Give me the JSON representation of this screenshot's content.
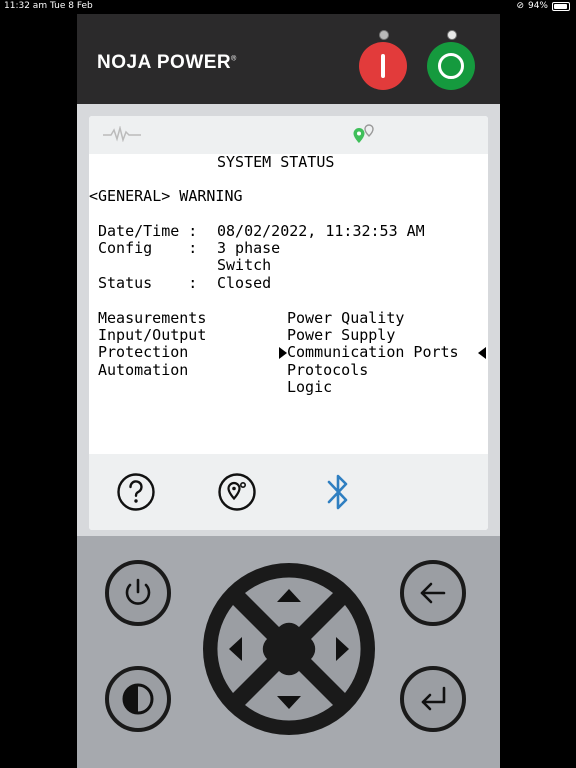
{
  "status_bar": {
    "time": "11:32 am",
    "date": "Tue 8 Feb",
    "battery": "94%",
    "battery_level": 0.94
  },
  "device": {
    "brand": "NOJA POWER",
    "brand_mark": "®",
    "colors": {
      "trip": "#e23b3b",
      "close": "#159a3e",
      "bluetooth": "#2f7fc1",
      "location_active": "#3fbf5a"
    }
  },
  "screen": {
    "title": "SYSTEM STATUS",
    "warning": "<GENERAL> WARNING",
    "fields": {
      "datetime_label": "Date/Time :",
      "datetime_value": "08/02/2022, 11:32:53 AM",
      "config_label": "Config    :",
      "config_value": "3 phase",
      "config_value2": "Switch",
      "status_label": "Status    :",
      "status_value": "Closed"
    },
    "menu_left": [
      "Measurements",
      "Input/Output",
      "Protection",
      "Automation"
    ],
    "menu_right": [
      "Power Quality",
      "Power Supply",
      "Communication Ports",
      "Protocols",
      "Logic"
    ],
    "selected_index": 2,
    "toolbar_icons": [
      "help-icon",
      "location-icon",
      "bluetooth-icon"
    ],
    "topbar_icons": [
      "waveform-icon",
      "location-pin-icon"
    ]
  },
  "keypad": {
    "buttons": [
      "power-icon",
      "contrast-icon",
      "back-arrow-icon",
      "enter-icon"
    ],
    "dpad": [
      "up-icon",
      "down-icon",
      "left-icon",
      "right-icon"
    ]
  }
}
